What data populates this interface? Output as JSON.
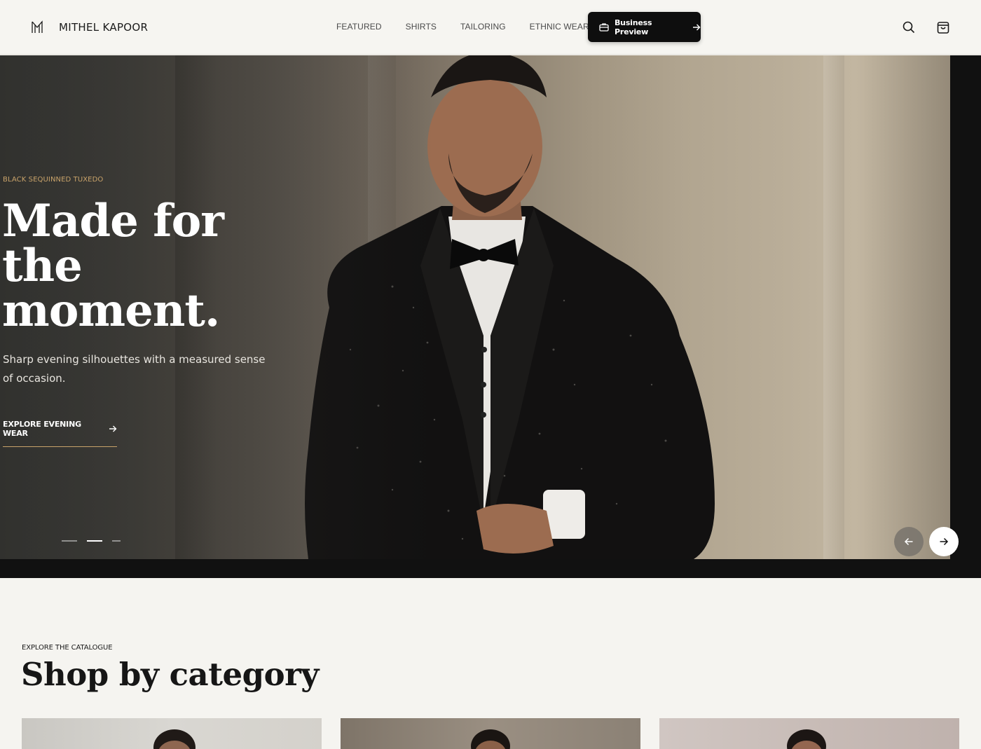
{
  "brand": {
    "name": "MITHEL KAPOOR",
    "logo_icon": "monogram-m-icon"
  },
  "nav": {
    "items": [
      {
        "label": "FEATURED"
      },
      {
        "label": "SHIRTS"
      },
      {
        "label": "TAILORING"
      },
      {
        "label": "ETHNIC WEAR"
      }
    ],
    "cta_label": "Business Preview",
    "cta_icon": "briefcase-icon"
  },
  "header_icons": {
    "search": "search-icon",
    "cart": "shopping-bag-icon"
  },
  "hero": {
    "eyebrow": "BLACK SEQUINNED TUXEDO",
    "title_lines": [
      "Made for",
      "the",
      "moment."
    ],
    "subtitle": "Sharp evening silhouettes with a measured sense of occasion.",
    "cta_label": "EXPLORE EVENING WEAR",
    "slides_total": 3,
    "active_slide": 2,
    "prev_icon": "arrow-left-icon",
    "next_icon": "arrow-right-icon"
  },
  "categories": {
    "eyebrow": "EXPLORE THE CATALOGUE",
    "title": "Shop by category",
    "cards": [
      {
        "id": "card-1"
      },
      {
        "id": "card-2"
      },
      {
        "id": "card-3"
      }
    ]
  },
  "colors": {
    "accent_gold": "#c9a36a",
    "header_bg": "#f6f5f1",
    "cta_bg": "#0e0e0e",
    "page_bg": "#f5f4f0"
  }
}
